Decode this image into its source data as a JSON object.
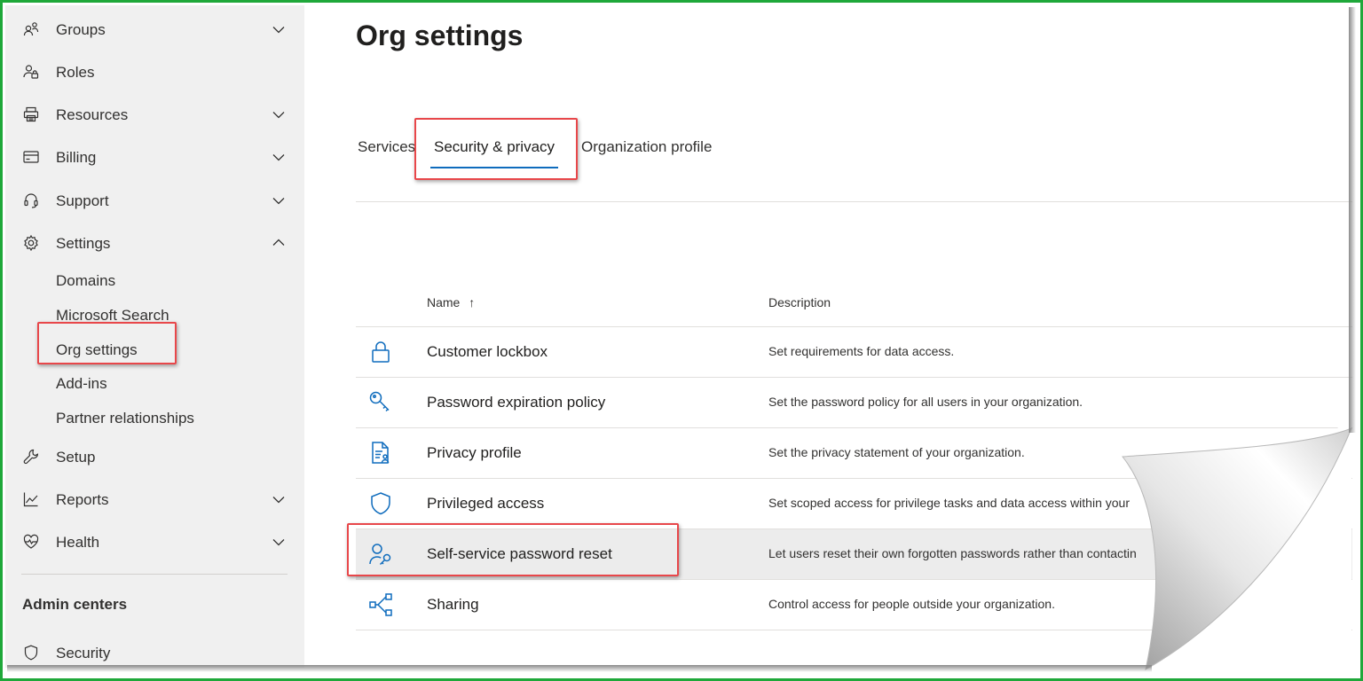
{
  "sidebar": {
    "items": [
      {
        "label": "Groups",
        "icon": "groups-icon",
        "chevron": "down"
      },
      {
        "label": "Roles",
        "icon": "roles-icon",
        "chevron": ""
      },
      {
        "label": "Resources",
        "icon": "resources-icon",
        "chevron": "down"
      },
      {
        "label": "Billing",
        "icon": "billing-icon",
        "chevron": "down"
      },
      {
        "label": "Support",
        "icon": "headset-icon",
        "chevron": "down"
      },
      {
        "label": "Settings",
        "icon": "gear-icon",
        "chevron": "up"
      }
    ],
    "settings_subitems": [
      "Domains",
      "Microsoft Search",
      "Org settings",
      "Add-ins",
      "Partner relationships"
    ],
    "lower_items": [
      {
        "label": "Setup",
        "icon": "wrench-icon",
        "chevron": ""
      },
      {
        "label": "Reports",
        "icon": "chart-icon",
        "chevron": "down"
      },
      {
        "label": "Health",
        "icon": "heart-icon",
        "chevron": "down"
      }
    ],
    "admin_centers_title": "Admin centers",
    "admin_centers": [
      {
        "label": "Security",
        "icon": "shield-icon"
      }
    ]
  },
  "main": {
    "title": "Org settings",
    "tabs": [
      {
        "label": "Services",
        "active": false
      },
      {
        "label": "Security & privacy",
        "active": true
      },
      {
        "label": "Organization profile",
        "active": false
      }
    ],
    "table": {
      "columns": {
        "name": "Name",
        "sort_glyph": "↑",
        "description": "Description"
      },
      "rows": [
        {
          "name": "Customer lockbox",
          "description": "Set requirements for data access.",
          "icon": "lock-icon"
        },
        {
          "name": "Password expiration policy",
          "description": "Set the password policy for all users in your organization.",
          "icon": "key-icon"
        },
        {
          "name": "Privacy profile",
          "description": "Set the privacy statement of your organization.",
          "icon": "document-person-icon"
        },
        {
          "name": "Privileged access",
          "description": "Set scoped access for privilege tasks and data access within your",
          "icon": "shield-icon"
        },
        {
          "name": "Self-service password reset",
          "description": "Let users reset their own forgotten passwords rather than contactin",
          "icon": "person-key-icon",
          "selected": true
        },
        {
          "name": "Sharing",
          "description": "Control access for people outside your organization.",
          "icon": "share-nodes-icon"
        }
      ]
    }
  },
  "colors": {
    "frame_border": "#1fa83a",
    "highlight_box": "#e8474a",
    "accent": "#0f6cbd",
    "sidebar_bg": "#f0f0f0"
  }
}
